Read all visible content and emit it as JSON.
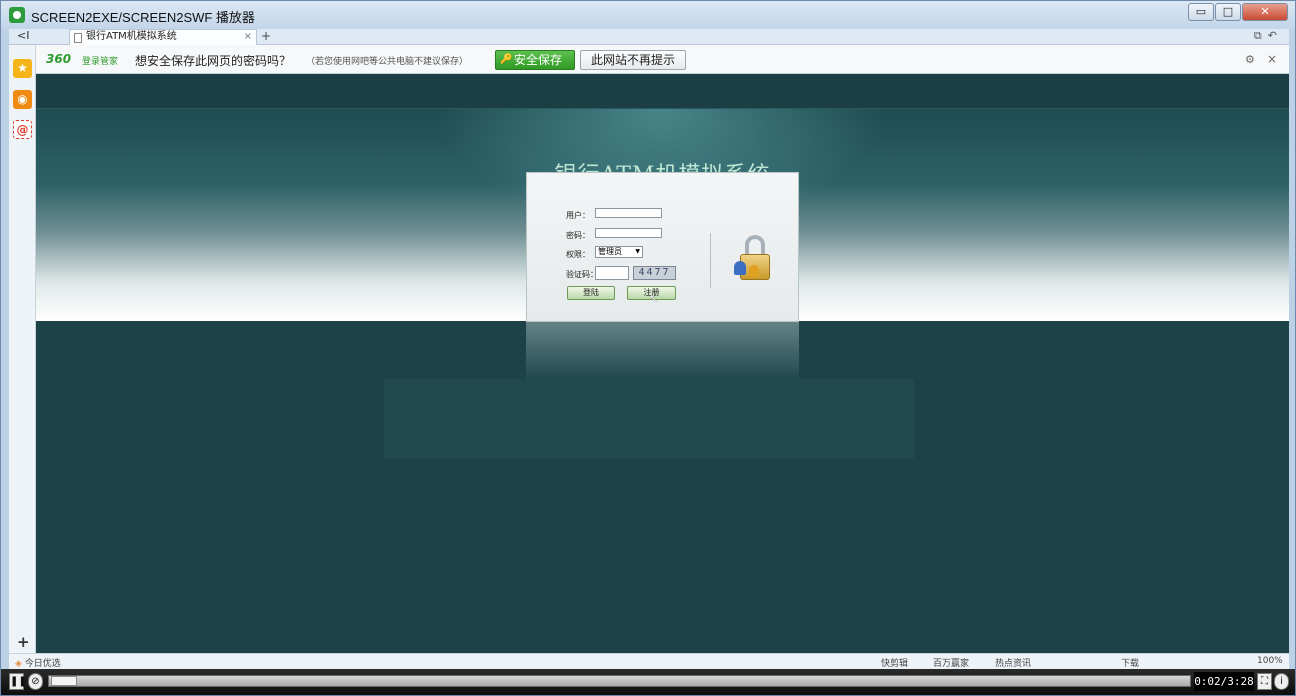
{
  "window": {
    "title": "SCREEN2EXE/SCREEN2SWF 播放器",
    "min_label": "▭",
    "max_label": "□",
    "close_label": "✕"
  },
  "tabbar": {
    "back_label": "<I",
    "tab_title": "银行ATM机模拟系统",
    "tab_close": "×",
    "add_label": "+"
  },
  "password_bar": {
    "brand": "360",
    "brand_sub": "登录管家",
    "question": "想安全保存此网页的密码吗？",
    "note": "（若您使用网吧等公共电脑不建议保存）",
    "save_label": "安全保存",
    "never_label": "此网站不再提示",
    "gear": "⚙",
    "close": "×"
  },
  "page": {
    "title": "银行ATM机模拟系统",
    "login": {
      "username_label": "用户：",
      "password_label": "密码：",
      "role_label": "权限：",
      "role_value": "管理员",
      "captcha_label": "验证码：",
      "captcha_value": "4477",
      "login_button": "登陆",
      "register_button": "注册"
    }
  },
  "statusbar": {
    "today": "今日优选",
    "items": [
      "快剪辑",
      "百万赢家",
      "热点资讯",
      "下载",
      "100%"
    ]
  },
  "player": {
    "time": "0:02/3:28",
    "pause_label": "❚❚"
  },
  "colors": {
    "content_bg": "#1d4248",
    "title_text": "#bfe6d2",
    "save_button": "#3aa52e",
    "captcha_bg": "#c9d0d8"
  }
}
